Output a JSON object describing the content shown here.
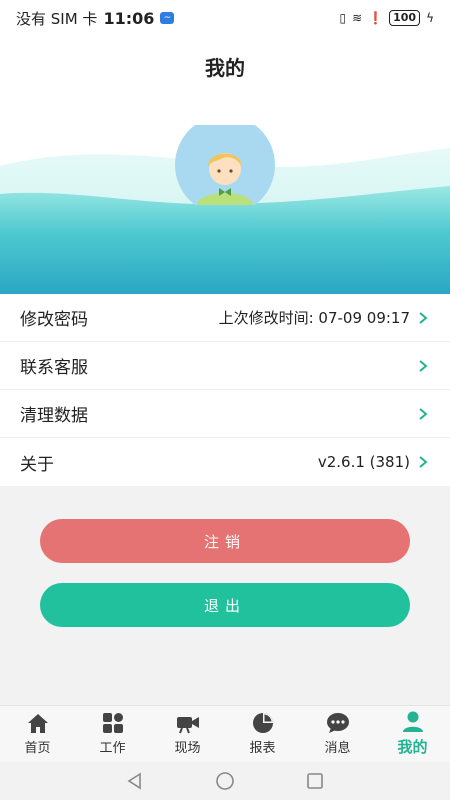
{
  "status_bar": {
    "carrier": "没有 SIM 卡",
    "time": "11:06",
    "battery": "100"
  },
  "page": {
    "title": "我的"
  },
  "menu": [
    {
      "label": "修改密码",
      "value": "上次修改时间: 07-09 09:17"
    },
    {
      "label": "联系客服",
      "value": ""
    },
    {
      "label": "清理数据",
      "value": ""
    },
    {
      "label": "关于",
      "value": "v2.6.1 (381)"
    }
  ],
  "buttons": {
    "cancel_account": "注销",
    "logout": "退出"
  },
  "tabs": [
    {
      "label": "首页",
      "icon": "home-icon"
    },
    {
      "label": "工作",
      "icon": "apps-icon"
    },
    {
      "label": "现场",
      "icon": "video-camera-icon"
    },
    {
      "label": "报表",
      "icon": "pie-chart-icon"
    },
    {
      "label": "消息",
      "icon": "chat-icon"
    },
    {
      "label": "我的",
      "icon": "user-icon",
      "active": true
    }
  ],
  "colors": {
    "accent": "#22c19e",
    "danger": "#e57373",
    "wave_top": "#7fe0e0",
    "wave_bottom": "#2aa8c8"
  }
}
